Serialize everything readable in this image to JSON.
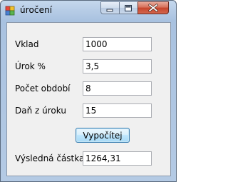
{
  "window": {
    "title": "úročení",
    "controls": {
      "minimize": "minimize",
      "maximize": "maximize",
      "close": "close"
    }
  },
  "form": {
    "fields": [
      {
        "label": "Vklad",
        "value": "1000"
      },
      {
        "label": "Úrok %",
        "value": "3,5"
      },
      {
        "label": "Počet období",
        "value": "8"
      },
      {
        "label": "Daň z úroku",
        "value": "15"
      }
    ],
    "calculate_button": "Vypočítej",
    "result": {
      "label": "Výsledná částka",
      "value": "1264,31"
    }
  },
  "colors": {
    "titlebar": "#b6cce6",
    "client_background": "#f0f0f0",
    "close_button": "#c7452c",
    "button_border": "#3c7fb1"
  },
  "icons": [
    "app-icon",
    "minimize-icon",
    "maximize-icon",
    "close-icon"
  ]
}
